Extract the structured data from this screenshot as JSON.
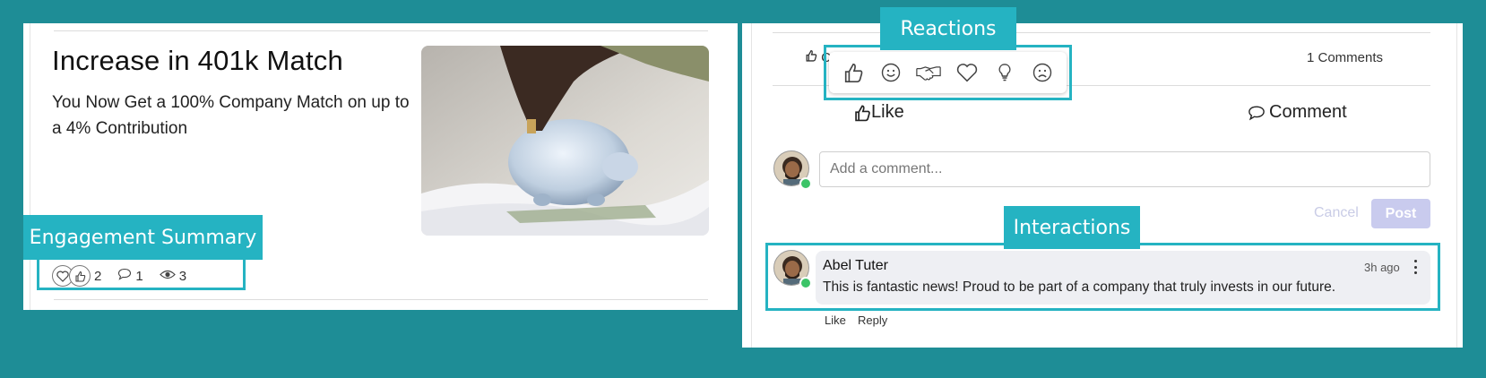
{
  "article": {
    "title": "Increase in 401k Match",
    "body": "You Now Get a 100% Company Match on up to a 4% Contribution"
  },
  "engagement": {
    "label": "Engagement Summary",
    "reactions_count": "2",
    "comments_count": "1",
    "views_count": "3"
  },
  "reactions_panel": {
    "label": "Reactions",
    "like_count_prefix": "C",
    "comments_summary": "1 Comments",
    "reactions": [
      "thumbs-up-icon",
      "smile-icon",
      "handshake-icon",
      "heart-icon",
      "lightbulb-icon",
      "frown-icon"
    ]
  },
  "actions": {
    "like_label": "Like",
    "comment_label": "Comment"
  },
  "comment_form": {
    "placeholder": "Add a comment...",
    "cancel_label": "Cancel",
    "post_label": "Post"
  },
  "interactions": {
    "label": "Interactions",
    "comment": {
      "author": "Abel Tuter",
      "time": "3h ago",
      "text": "This is fantastic news! Proud to be part of a company that truly invests in our future.",
      "like_label": "Like",
      "reply_label": "Reply"
    }
  },
  "colors": {
    "background": "#1e8d96",
    "callout": "#25b3c2",
    "online": "#3cc468",
    "post_button": "#c9cbee"
  }
}
